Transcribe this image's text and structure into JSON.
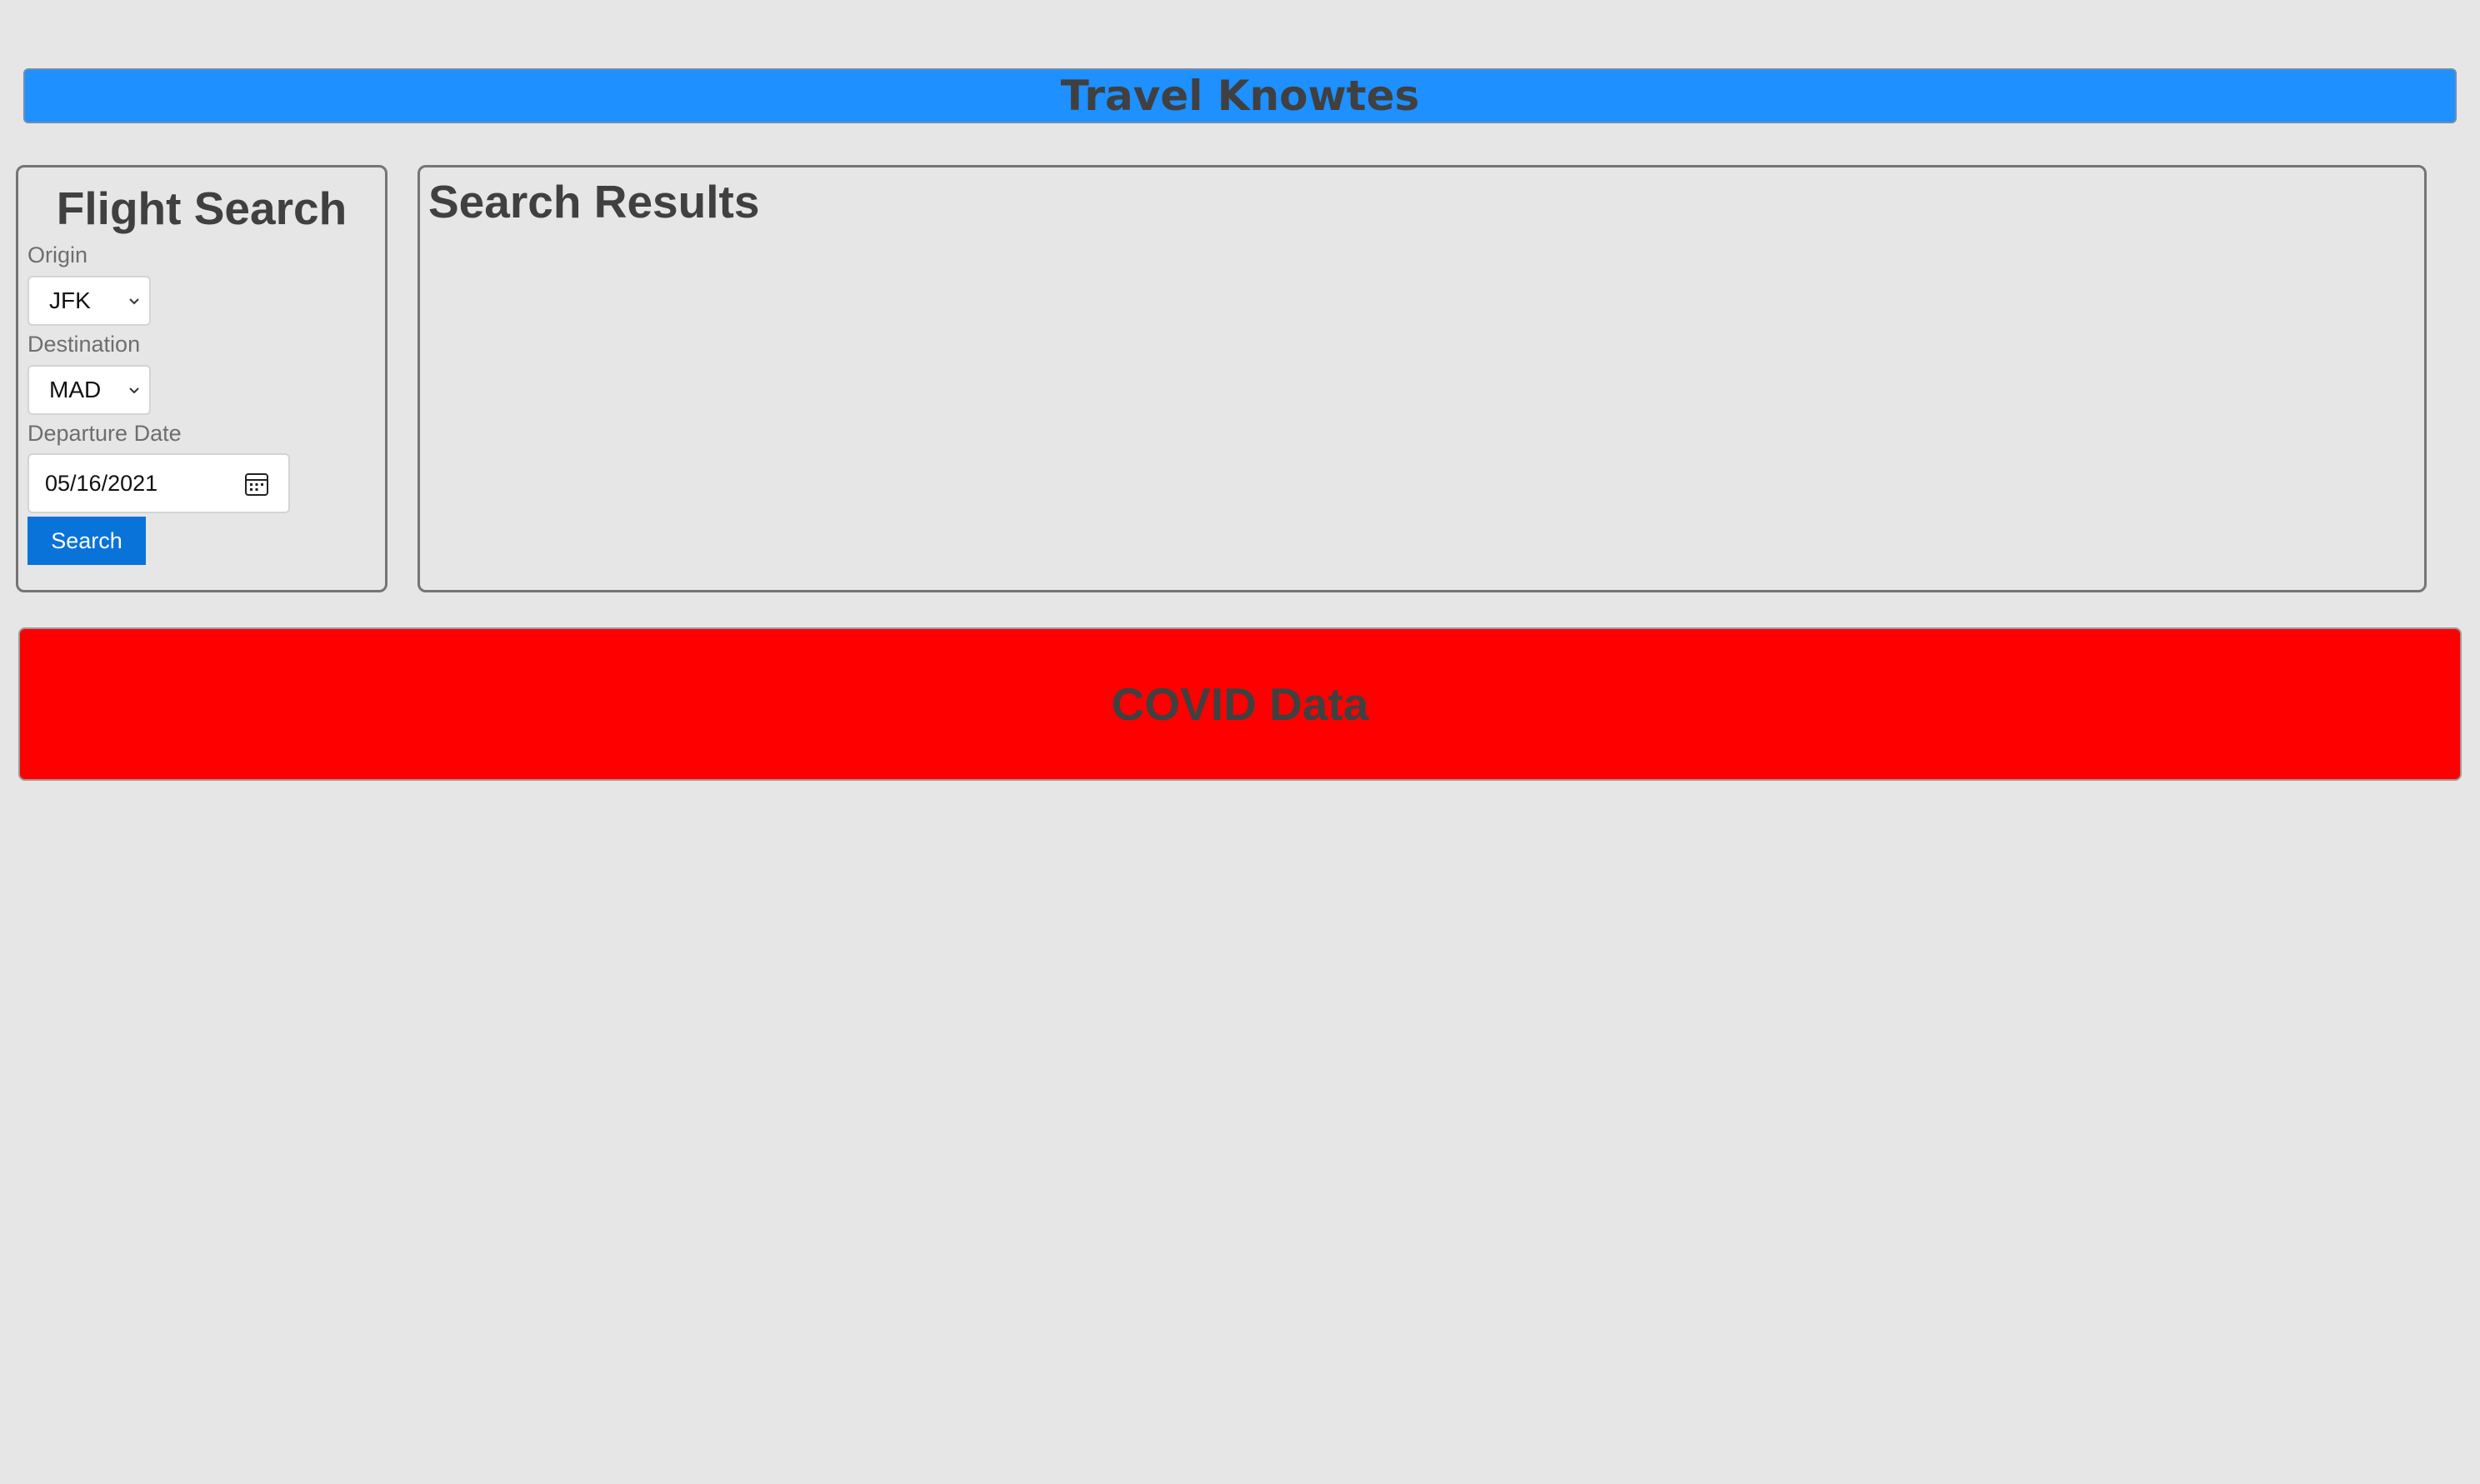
{
  "header": {
    "title": "Travel Knowtes",
    "background_color": "#1e90ff"
  },
  "flight_search": {
    "title": "Flight Search",
    "origin": {
      "label": "Origin",
      "value": "JFK"
    },
    "destination": {
      "label": "Destination",
      "value": "MAD"
    },
    "departure_date": {
      "label": "Departure Date",
      "value": "05/16/2021",
      "icon": "calendar-icon"
    },
    "search_button": {
      "label": "Search",
      "color": "#0a73d9"
    }
  },
  "search_results": {
    "title": "Search Results"
  },
  "covid": {
    "title": "COVID Data",
    "background_color": "#ff0000"
  }
}
